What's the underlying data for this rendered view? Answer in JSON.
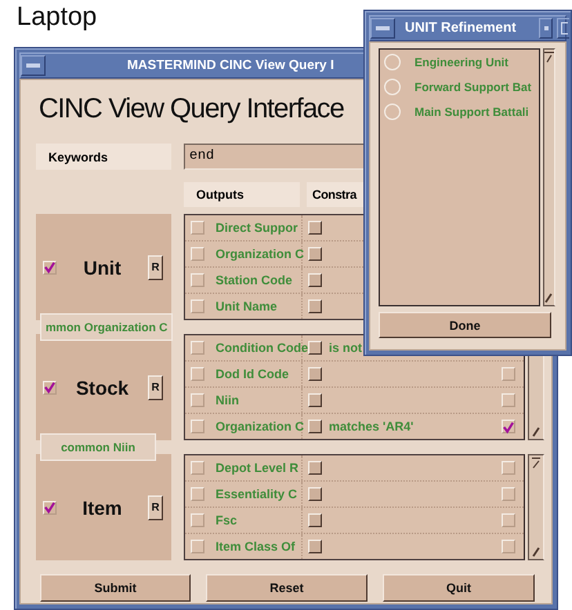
{
  "desktop_label": "Laptop",
  "main_window": {
    "title": "MASTERMIND CINC View Query I",
    "heading": "CINC View Query Interface",
    "keywords_label": "Keywords",
    "keywords": "end",
    "headers": [
      "Outputs",
      "Constra"
    ],
    "sections": [
      {
        "name": "Unit",
        "checked": true,
        "refine": "R",
        "rows": [
          {
            "label": "Direct Suppor",
            "output": false
          },
          {
            "label": "Organization C",
            "output": false
          },
          {
            "label": "Station Code",
            "output": false
          },
          {
            "label": "Unit Name",
            "output": false
          }
        ],
        "link": "mmon Organization C"
      },
      {
        "name": "Stock",
        "checked": true,
        "refine": "R",
        "scroll_up": false,
        "scroll_down": true,
        "rows": [
          {
            "label": "Condition Code",
            "output": false,
            "constraint": "is not"
          },
          {
            "label": "Dod Id Code",
            "output": false,
            "selected": false
          },
          {
            "label": "Niin",
            "output": false,
            "selected": false
          },
          {
            "label": "Organization C",
            "output": false,
            "constraint": "matches 'AR4'",
            "selected": true
          }
        ],
        "link": "common Niin"
      },
      {
        "name": "Item",
        "checked": true,
        "refine": "R",
        "scroll_up": true,
        "scroll_down": true,
        "rows": [
          {
            "label": "Depot Level R",
            "output": false,
            "selected": false
          },
          {
            "label": "Essentiality C",
            "output": false,
            "selected": false
          },
          {
            "label": "Fsc",
            "output": false,
            "selected": false
          },
          {
            "label": "Item Class Of",
            "output": false,
            "selected": false
          }
        ]
      }
    ],
    "buttons": [
      "Submit",
      "Reset",
      "Quit"
    ]
  },
  "refine_window": {
    "title": "UNIT Refinement",
    "options": [
      {
        "label": "Engineering Unit",
        "selected": false
      },
      {
        "label": "Forward Support Bat",
        "selected": false
      },
      {
        "label": "Main Support Battali",
        "selected": false
      }
    ],
    "button": "Done"
  }
}
